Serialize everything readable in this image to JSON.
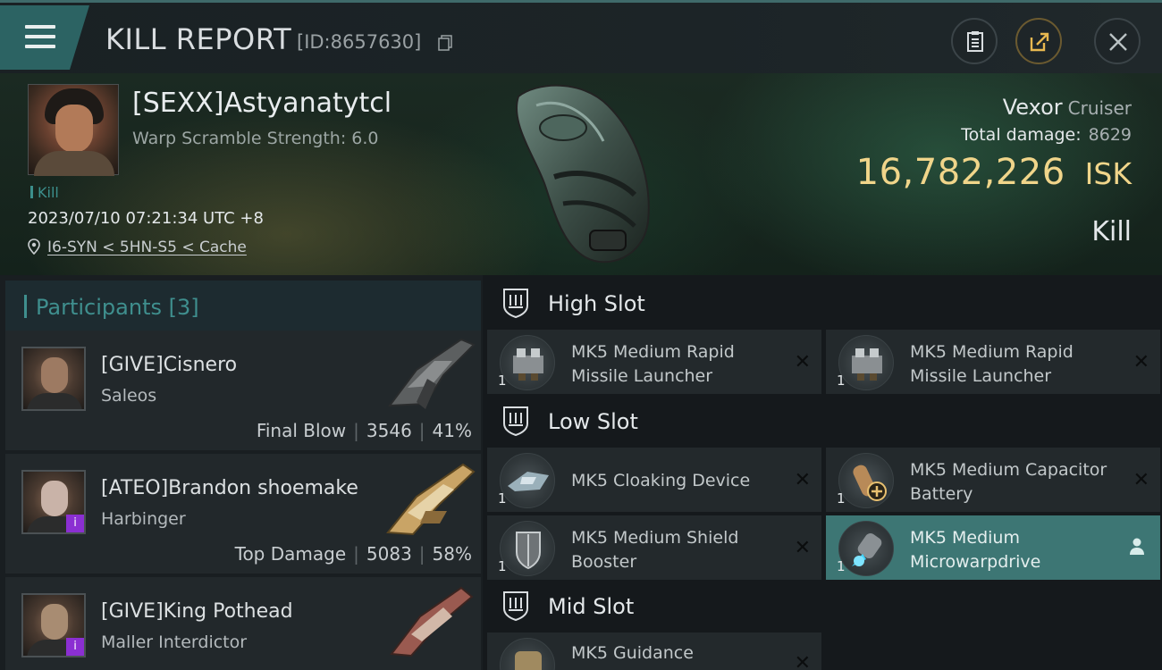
{
  "header": {
    "title": "KILL REPORT",
    "report_id": "[ID:8657630]"
  },
  "victim": {
    "name": "[SEXX]Astyanatytcl",
    "warp_scramble": "Warp Scramble Strength: 6.0",
    "kill_tag": "Kill",
    "timestamp": "2023/07/10 07:21:34 UTC +8",
    "location": "I6-SYN < 5HN-S5 < Cache",
    "ship_name": "Vexor",
    "ship_class": "Cruiser",
    "total_damage_label": "Total damage:",
    "total_damage": "8629",
    "isk_value": "16,782,226",
    "isk_unit": "ISK",
    "result_label": "Kill"
  },
  "participants": {
    "title": "Participants [3]",
    "list": [
      {
        "name": "[GIVE]Cisnero",
        "ship": "Saleos",
        "role": "Final Blow",
        "damage": "3546",
        "percent": "41%"
      },
      {
        "name": "[ATEO]Brandon shoemake",
        "ship": "Harbinger",
        "role": "Top Damage",
        "damage": "5083",
        "percent": "58%",
        "badge": "i"
      },
      {
        "name": "[GIVE]King Pothead",
        "ship": "Maller Interdictor",
        "badge": "i"
      }
    ]
  },
  "slots": {
    "high": {
      "title": "High Slot",
      "modules": [
        {
          "name": "MK5 Medium Rapid Missile Launcher",
          "qty": "1"
        },
        {
          "name": "MK5 Medium Rapid Missile Launcher",
          "qty": "1"
        }
      ]
    },
    "low": {
      "title": "Low Slot",
      "modules": [
        {
          "name": "MK5 Cloaking Device",
          "qty": "1"
        },
        {
          "name": "MK5 Medium Capacitor Battery",
          "qty": "1"
        },
        {
          "name": "MK5 Medium Shield Booster",
          "qty": "1"
        },
        {
          "name": "MK5 Medium Microwarpdrive",
          "qty": "1"
        }
      ]
    },
    "mid": {
      "title": "Mid Slot",
      "modules": [
        {
          "name": "MK5 Guidance",
          "qty": ""
        }
      ]
    }
  },
  "colors": {
    "accent_teal": "#3f8f8e",
    "isk_gold": "#f0d58a",
    "active_module": "#3d7674",
    "badge_purple": "#8b2fd2"
  },
  "icons": [
    "menu-icon",
    "copy-icon",
    "clipboard-icon",
    "share-icon",
    "close-icon",
    "location-pin-icon",
    "slot-shield-icon",
    "person-icon"
  ]
}
